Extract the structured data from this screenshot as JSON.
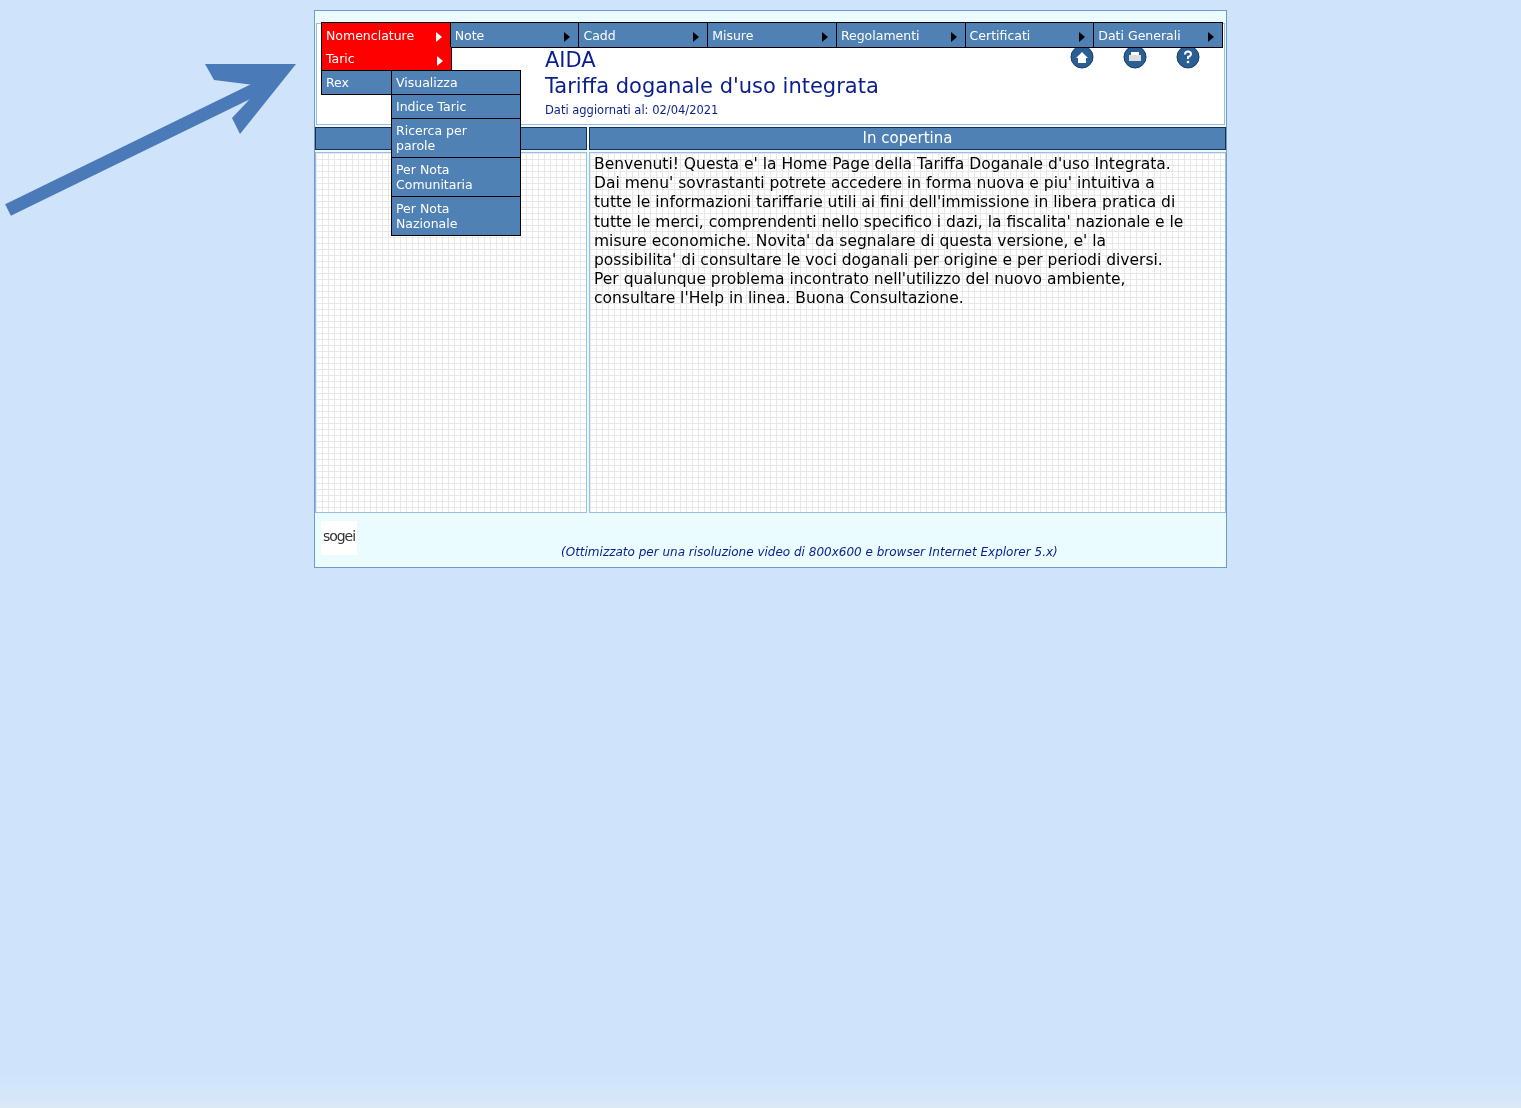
{
  "menu_bar": [
    {
      "label": "Nomenclature",
      "selected": true
    },
    {
      "label": "Note",
      "selected": false
    },
    {
      "label": "Cadd",
      "selected": false
    },
    {
      "label": "Misure",
      "selected": false
    },
    {
      "label": "Regolamenti",
      "selected": false
    },
    {
      "label": "Certificati",
      "selected": false
    },
    {
      "label": "Dati Generali",
      "selected": false
    }
  ],
  "dropdown": [
    {
      "label": "Taric",
      "selected": true
    },
    {
      "label": "Rex",
      "selected": false
    }
  ],
  "submenu": [
    "Visualizza",
    "Indice Taric",
    "Ricerca per parole",
    "Per Nota Comunitaria",
    "Per Nota Nazionale"
  ],
  "header": {
    "app_name": "AIDA",
    "title": "Tariffa doganale d'uso integrata",
    "updated": "Dati aggiornati al: 02/04/2021"
  },
  "main_panel": {
    "heading": "In copertina",
    "text": "Benvenuti! Questa e' la Home Page della Tariffa Doganale d'uso Integrata. Dai menu' sovrastanti potrete accedere in forma nuova e piu' intuitiva a tutte le informazioni tariffarie utili ai fini dell'immissione in libera pratica di tutte le merci, comprendenti nello specifico i dazi, la fiscalita' nazionale e le misure economiche. Novita' da segnalare di questa versione, e' la possibilita' di consultare le voci doganali per origine e per periodi diversi. Per qualunque problema incontrato nell'utilizzo del nuovo ambiente, consultare l'Help in linea. Buona Consultazione."
  },
  "footer": {
    "logo": "sogei",
    "note": "(Ottimizzato per una risoluzione video di 800x600 e browser Internet Explorer 5.x)"
  },
  "annotation_arrow": true
}
